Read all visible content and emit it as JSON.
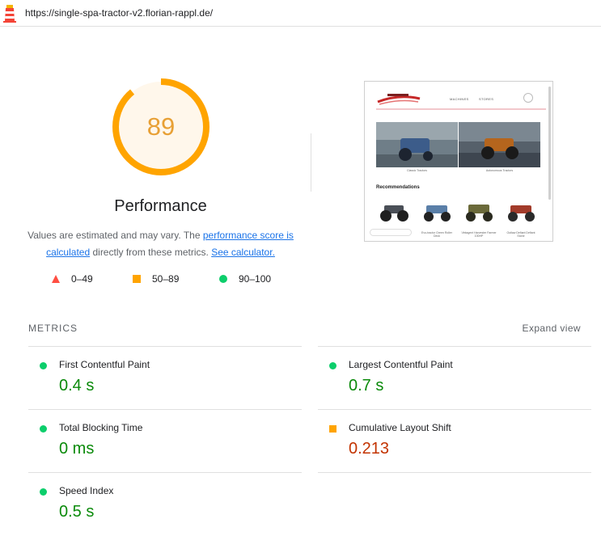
{
  "browser": {
    "url": "https://single-spa-tractor-v2.florian-rappl.de/"
  },
  "colors": {
    "pass": "#0cce6b",
    "average": "#ffa400",
    "fail": "#ff4e42",
    "average_text": "#e8a035",
    "pass_text": "#0a8a0a",
    "fail_text": "#c33300",
    "link": "#1a73e8"
  },
  "gauge": {
    "score": "89",
    "score_fraction": 0.89,
    "title": "Performance"
  },
  "description": {
    "text_before": "Values are estimated and may vary. The ",
    "link1": "performance score is calculated",
    "text_middle": " directly from these metrics. ",
    "link2": "See calculator."
  },
  "legend": [
    {
      "icon": "triangle-icon",
      "label": "0–49"
    },
    {
      "icon": "square-icon",
      "label": "50–89"
    },
    {
      "icon": "circle-icon",
      "label": "90–100"
    }
  ],
  "thumbnail": {
    "nav_items": [
      "MACHINES",
      "STORES"
    ],
    "recommendations_title": "Recommendations",
    "hero_captions": [
      "Classic Tractors",
      "Autonomous Tractors"
    ],
    "product_captions": [
      "",
      "Evo-tractor Green Roller Deck",
      "Vintagent Harvester Farmer 100HP",
      "Outlaw Defiant Defiant Stone"
    ]
  },
  "metrics": {
    "heading": "METRICS",
    "expand_label": "Expand view",
    "items": [
      {
        "name": "First Contentful Paint",
        "value": "0.4 s",
        "rating": "pass"
      },
      {
        "name": "Largest Contentful Paint",
        "value": "0.7 s",
        "rating": "pass"
      },
      {
        "name": "Total Blocking Time",
        "value": "0 ms",
        "rating": "pass"
      },
      {
        "name": "Cumulative Layout Shift",
        "value": "0.213",
        "rating": "average"
      },
      {
        "name": "Speed Index",
        "value": "0.5 s",
        "rating": "pass"
      }
    ]
  }
}
